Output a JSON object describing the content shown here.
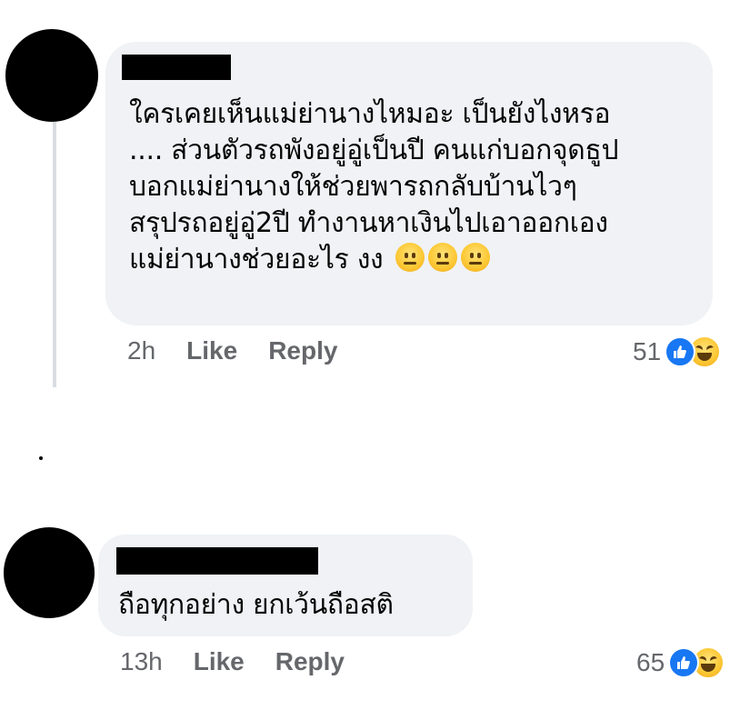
{
  "comments": [
    {
      "author_name": "",
      "text_lines": [
        "ใครเคยเห็นแม่ย่านางไหมอะ เป็นยังไงหรอ",
        ".... ส่วนตัวรถพังอยู่อู่เป็นปี คนแก่บอกจุดธูป",
        "บอกแม่ย่านางให้ช่วยพารถกลับบ้านไวๆ",
        "สรุปรถอยู่อู่2ปี ทำงานหาเงินไปเอาออกเอง",
        "แม่ย่านางช่วยอะไร งง"
      ],
      "emojis": [
        "neutral-face-emoji",
        "neutral-face-emoji",
        "neutral-face-emoji"
      ],
      "time": "2h",
      "like_label": "Like",
      "reply_label": "Reply",
      "reaction_count": "51",
      "reaction_icons": [
        "like-reaction-icon",
        "haha-reaction-icon"
      ]
    },
    {
      "author_name": "",
      "text_lines": [
        "ถือทุกอย่าง ยกเว้นถือสติ"
      ],
      "time": "13h",
      "like_label": "Like",
      "reply_label": "Reply",
      "reaction_count": "65",
      "reaction_icons": [
        "like-reaction-icon",
        "haha-reaction-icon"
      ]
    }
  ],
  "colors": {
    "bubble_bg": "#f0f2f5",
    "meta_text": "#65676b",
    "like_blue": "#1877f2",
    "haha_yellow": "#fcc936"
  }
}
